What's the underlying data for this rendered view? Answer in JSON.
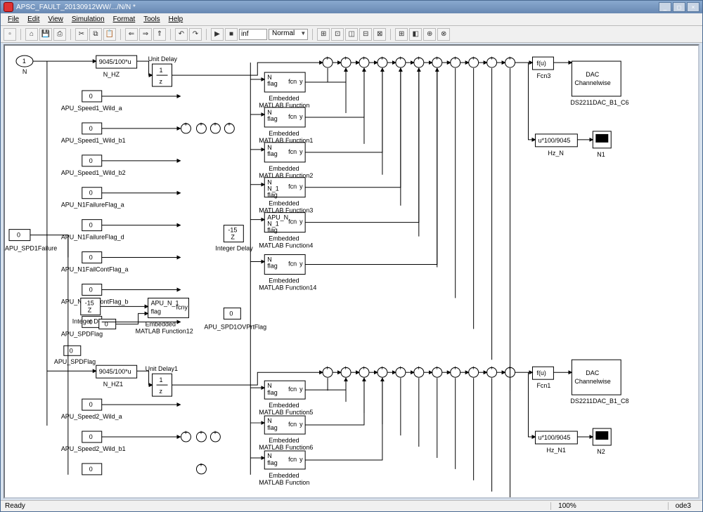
{
  "title": "APSC_FAULT_20130912WW/.../N/N *",
  "menus": [
    "File",
    "Edit",
    "View",
    "Simulation",
    "Format",
    "Tools",
    "Help"
  ],
  "stop_time": "inf",
  "sim_mode": "Normal",
  "status_ready": "Ready",
  "status_zoom": "100%",
  "status_solver": "ode3",
  "window_buttons": {
    "min": "_",
    "max": "◻",
    "close": "×"
  },
  "port_in": {
    "num": "1",
    "label": "N"
  },
  "apu_spd1": "APU_SPD1Failure",
  "gain_top": {
    "body": "9045/100*u",
    "label": "N_HZ"
  },
  "unit_delay": {
    "body": "1\n—\nz",
    "label": "Unit Delay"
  },
  "const_labels_top": [
    "APU_Speed1_Wild_a",
    "APU_Speed1_Wild_b1",
    "APU_Speed1_Wild_b2",
    "APU_N1FailureFlag_a",
    "APU_N1FailureFlag_d",
    "APU_N1FailContFlag_a",
    "APU_N1FailContFlag_b",
    "APU_SPDFlag"
  ],
  "fcn_common": {
    "ports": "N\nflag",
    "out": "y",
    "sub": "fcn",
    "caption": "Embedded\nMATLAB Function"
  },
  "fcn_labels": [
    "",
    "1",
    "2",
    "3",
    "4",
    "14"
  ],
  "fcn3_ports": "N\nN_1\nflag",
  "fcn4_ports": "APU_N\nN_1\nflag",
  "fcn12": {
    "ports": "APU_N_1\nflag",
    "label": "Embedded\nMATLAB Function12"
  },
  "intdelay": {
    "body": "-15\nZ",
    "label": "Integer Delay"
  },
  "ovprt": "APU_SPD1OVPrtFlag",
  "fcn_main": {
    "body": "f(u)",
    "label": "Fcn3"
  },
  "dac": {
    "body": "DAC\nChannelwise",
    "label": "DS2211DAC_B1_C6"
  },
  "hz_n_gain": {
    "body": "u*100/9045",
    "label": "Hz_N"
  },
  "scope": "N1",
  "gain_bot": {
    "body": "9045/100*u",
    "label": "N_HZ1"
  },
  "unit_delay1": {
    "body": "1\n—\nz",
    "label": "Unit Delay1"
  },
  "const_labels_bot": [
    "APU_Speed2_Wild_a",
    "APU_Speed2_Wild_b1"
  ],
  "fcn_bot_labels": [
    "5",
    "6"
  ],
  "fcn1": {
    "body": "f(u)",
    "label": "Fcn1"
  },
  "dac1": {
    "body": "DAC\nChannelwise",
    "label": "DS2211DAC_B1_C8"
  },
  "hz_n1_gain": {
    "body": "u*100/9045",
    "label": "Hz_N1"
  },
  "scope1": "N2",
  "const_val": "0"
}
